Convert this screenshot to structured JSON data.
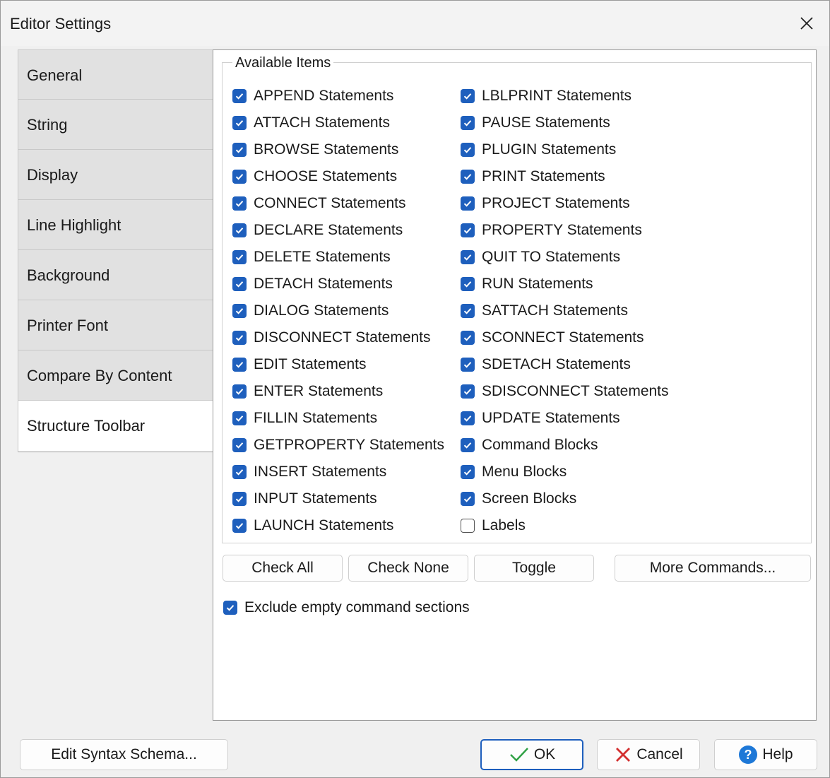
{
  "window": {
    "title": "Editor Settings"
  },
  "tabs": [
    {
      "label": "General"
    },
    {
      "label": "String"
    },
    {
      "label": "Display"
    },
    {
      "label": "Line Highlight"
    },
    {
      "label": "Background"
    },
    {
      "label": "Printer Font"
    },
    {
      "label": "Compare By Content"
    },
    {
      "label": "Structure Toolbar",
      "selected": true
    }
  ],
  "available_items": {
    "group_label": "Available Items",
    "column1": [
      {
        "label": "APPEND Statements",
        "checked": true
      },
      {
        "label": "ATTACH Statements",
        "checked": true
      },
      {
        "label": "BROWSE Statements",
        "checked": true
      },
      {
        "label": "CHOOSE Statements",
        "checked": true
      },
      {
        "label": "CONNECT Statements",
        "checked": true
      },
      {
        "label": "DECLARE Statements",
        "checked": true
      },
      {
        "label": "DELETE Statements",
        "checked": true
      },
      {
        "label": "DETACH Statements",
        "checked": true
      },
      {
        "label": "DIALOG Statements",
        "checked": true
      },
      {
        "label": "DISCONNECT Statements",
        "checked": true
      },
      {
        "label": "EDIT Statements",
        "checked": true
      },
      {
        "label": "ENTER Statements",
        "checked": true
      },
      {
        "label": "FILLIN Statements",
        "checked": true
      },
      {
        "label": "GETPROPERTY Statements",
        "checked": true
      },
      {
        "label": "INSERT Statements",
        "checked": true
      },
      {
        "label": "INPUT Statements",
        "checked": true
      },
      {
        "label": "LAUNCH Statements",
        "checked": true
      }
    ],
    "column2": [
      {
        "label": "LBLPRINT Statements",
        "checked": true
      },
      {
        "label": "PAUSE Statements",
        "checked": true
      },
      {
        "label": "PLUGIN Statements",
        "checked": true
      },
      {
        "label": "PRINT Statements",
        "checked": true
      },
      {
        "label": "PROJECT Statements",
        "checked": true
      },
      {
        "label": "PROPERTY Statements",
        "checked": true
      },
      {
        "label": "QUIT TO Statements",
        "checked": true
      },
      {
        "label": "RUN Statements",
        "checked": true
      },
      {
        "label": "SATTACH Statements",
        "checked": true
      },
      {
        "label": "SCONNECT Statements",
        "checked": true
      },
      {
        "label": "SDETACH Statements",
        "checked": true
      },
      {
        "label": "SDISCONNECT Statements",
        "checked": true
      },
      {
        "label": "UPDATE Statements",
        "checked": true
      },
      {
        "label": "Command Blocks",
        "checked": true
      },
      {
        "label": "Menu Blocks",
        "checked": true
      },
      {
        "label": "Screen Blocks",
        "checked": true
      },
      {
        "label": "Labels",
        "checked": false
      }
    ]
  },
  "actions": {
    "check_all": "Check All",
    "check_none": "Check None",
    "toggle": "Toggle",
    "more_commands": "More Commands..."
  },
  "exclude_empty": {
    "label": "Exclude empty command sections",
    "checked": true
  },
  "footer": {
    "edit_syntax": "Edit Syntax Schema...",
    "ok": "OK",
    "cancel": "Cancel",
    "help": "Help"
  },
  "colors": {
    "accent": "#1e5fbd",
    "ok_check": "#2ea043",
    "cancel_x": "#d32f2f"
  }
}
